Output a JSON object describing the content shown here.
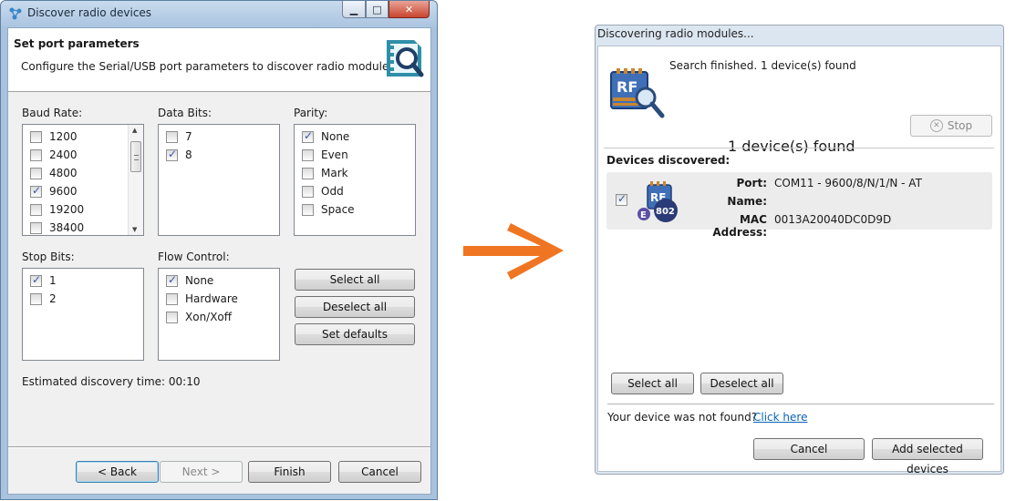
{
  "discover_window": {
    "title": "Discover radio devices",
    "header": {
      "title": "Set port parameters",
      "subtitle": "Configure the Serial/USB port parameters to discover radio modules."
    },
    "baud_rate": {
      "label": "Baud Rate:",
      "items": [
        {
          "label": "1200",
          "checked": false
        },
        {
          "label": "2400",
          "checked": false
        },
        {
          "label": "4800",
          "checked": false
        },
        {
          "label": "9600",
          "checked": true
        },
        {
          "label": "19200",
          "checked": false
        },
        {
          "label": "38400",
          "checked": false
        }
      ]
    },
    "data_bits": {
      "label": "Data Bits:",
      "items": [
        {
          "label": "7",
          "checked": false
        },
        {
          "label": "8",
          "checked": true
        }
      ]
    },
    "parity": {
      "label": "Parity:",
      "items": [
        {
          "label": "None",
          "checked": true
        },
        {
          "label": "Even",
          "checked": false
        },
        {
          "label": "Mark",
          "checked": false
        },
        {
          "label": "Odd",
          "checked": false
        },
        {
          "label": "Space",
          "checked": false
        }
      ]
    },
    "stop_bits": {
      "label": "Stop Bits:",
      "items": [
        {
          "label": "1",
          "checked": true
        },
        {
          "label": "2",
          "checked": false
        }
      ]
    },
    "flow_control": {
      "label": "Flow Control:",
      "items": [
        {
          "label": "None",
          "checked": true
        },
        {
          "label": "Hardware",
          "checked": false
        },
        {
          "label": "Xon/Xoff",
          "checked": false
        }
      ]
    },
    "select_all": "Select all",
    "deselect_all": "Deselect all",
    "set_defaults": "Set defaults",
    "estimated": "Estimated discovery time: 00:10",
    "back": "< Back",
    "next": "Next >",
    "finish": "Finish",
    "cancel": "Cancel"
  },
  "discovering_window": {
    "title": "Discovering radio modules...",
    "status": "Search finished. 1 device(s) found",
    "found_count": "1 device(s) found",
    "stop": "Stop",
    "devices_label": "Devices discovered:",
    "device": {
      "checked": true,
      "port_label": "Port:",
      "port_value": "COM11 - 9600/8/N/1/N - AT",
      "name_label": "Name:",
      "name_value": "",
      "mac_label": "MAC Address:",
      "mac_value": "0013A20040DC0D9D"
    },
    "select_all": "Select all",
    "deselect_all": "Deselect all",
    "not_found": "Your device was not found?",
    "click_here": "Click here",
    "cancel": "Cancel",
    "add_selected": "Add selected devices"
  },
  "colors": {
    "arrow": "#f07522",
    "link": "#0b63b8"
  }
}
